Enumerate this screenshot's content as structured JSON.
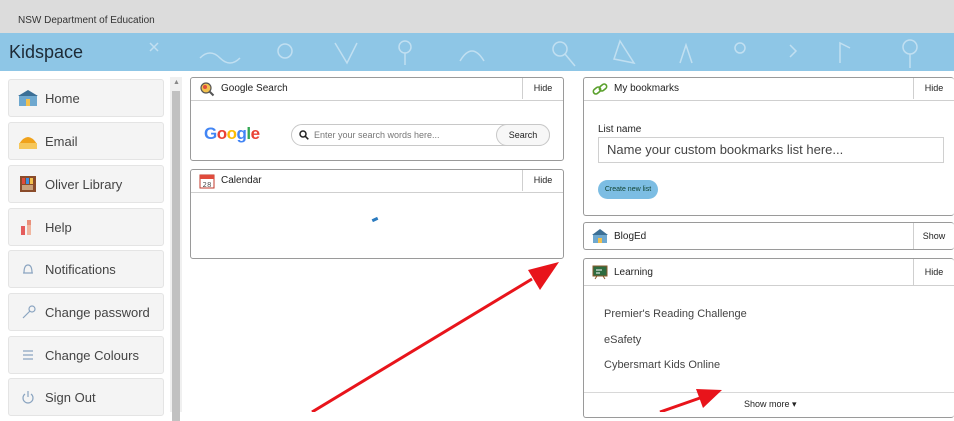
{
  "topbar": {
    "org": "NSW Department of Education"
  },
  "banner": {
    "title": "Kidspace",
    "color": "#8ec6e6"
  },
  "sidebar": {
    "items": [
      {
        "label": "Home",
        "icon": "school-icon"
      },
      {
        "label": "Email",
        "icon": "mail-icon"
      },
      {
        "label": "Oliver Library",
        "icon": "library-icon"
      },
      {
        "label": "Help",
        "icon": "help-icon"
      },
      {
        "label": "Notifications",
        "icon": "bell-icon"
      },
      {
        "label": "Change password",
        "icon": "key-icon"
      },
      {
        "label": "Change Colours",
        "icon": "list-icon"
      },
      {
        "label": "Sign Out",
        "icon": "power-icon"
      }
    ]
  },
  "google_search": {
    "title": "Google Search",
    "toggle": "Hide",
    "logo": "Google",
    "placeholder": "Enter your search words here...",
    "button": "Search"
  },
  "calendar": {
    "title": "Calendar",
    "toggle": "Hide",
    "icon_day": "28"
  },
  "bookmarks": {
    "title": "My bookmarks",
    "toggle": "Hide",
    "list_name_label": "List name",
    "list_name_placeholder": "Name your custom bookmarks list here...",
    "create_button": "Create new list"
  },
  "bloged": {
    "title": "BlogEd",
    "toggle": "Show"
  },
  "learning": {
    "title": "Learning",
    "toggle": "Hide",
    "links": [
      "Premier's Reading Challenge",
      "eSafety",
      "Cybersmart Kids Online"
    ],
    "show_more": "Show more ▾"
  },
  "colors": {
    "annotation_arrow": "#e8141b",
    "button_accent": "#7cbde3"
  }
}
